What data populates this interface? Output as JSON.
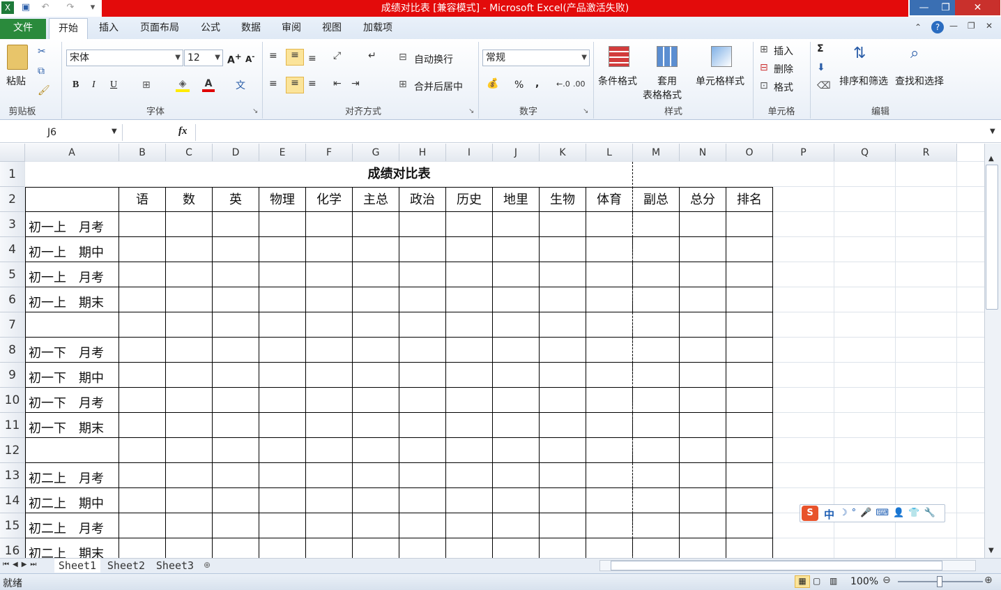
{
  "window": {
    "title": "成绩对比表  [兼容模式]  -  Microsoft Excel(产品激活失败)"
  },
  "tabs": [
    "文件",
    "开始",
    "插入",
    "页面布局",
    "公式",
    "数据",
    "审阅",
    "视图",
    "加载项"
  ],
  "active_tab": "开始",
  "ribbon": {
    "clipboard": {
      "paste": "粘贴",
      "label": "剪贴板"
    },
    "font": {
      "name": "宋体",
      "size": "12",
      "bold": "B",
      "italic": "I",
      "underline": "U",
      "label": "字体"
    },
    "alignment": {
      "wrap": "自动换行",
      "merge": "合并后居中",
      "label": "对齐方式"
    },
    "number": {
      "format": "常规",
      "percent": "%",
      "comma": ",",
      "label": "数字"
    },
    "styles": {
      "cond": "条件格式",
      "table1": "套用",
      "table2": "表格格式",
      "cell": "单元格样式",
      "label": "样式"
    },
    "cells": {
      "insert": "插入",
      "delete": "删除",
      "format": "格式",
      "label": "单元格"
    },
    "editing": {
      "sum": "Σ",
      "sort": "排序和筛选",
      "find": "查找和选择",
      "label": "编辑"
    }
  },
  "formula_bar": {
    "name_box": "J6",
    "fx": "fx",
    "value": ""
  },
  "columns": [
    "A",
    "B",
    "C",
    "D",
    "E",
    "F",
    "G",
    "H",
    "I",
    "J",
    "K",
    "L",
    "M",
    "N",
    "O",
    "P",
    "Q",
    "R"
  ],
  "rows": [
    "1",
    "2",
    "3",
    "4",
    "5",
    "6",
    "7",
    "8",
    "9",
    "10",
    "11",
    "12",
    "13",
    "14",
    "15",
    "16"
  ],
  "sheet": {
    "title": "成绩对比表",
    "headers": [
      "语",
      "数",
      "英",
      "物理",
      "化学",
      "主总",
      "政治",
      "历史",
      "地里",
      "生物",
      "体育",
      "副总",
      "总分",
      "排名"
    ],
    "row_labels": [
      "初一上　月考",
      "初一上　期中",
      "初一上　月考",
      "初一上　期末",
      "",
      "初一下　月考",
      "初一下　期中",
      "初一下　月考",
      "初一下　期末",
      "",
      "初二上　月考",
      "初二上　期中",
      "初二上　月考",
      "初二上　期末"
    ]
  },
  "sheet_tabs": [
    "Sheet1",
    "Sheet2",
    "Sheet3"
  ],
  "status": {
    "mode": "就绪",
    "zoom": "100%"
  },
  "ime": {
    "mode": "中"
  }
}
